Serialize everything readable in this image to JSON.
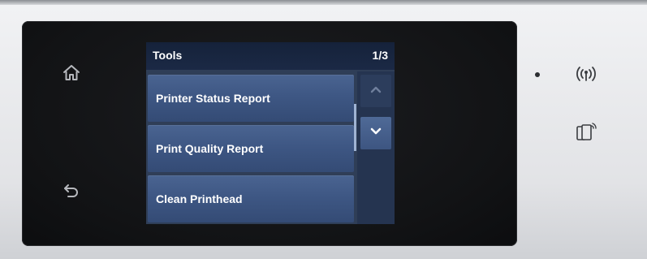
{
  "screen": {
    "title": "Tools",
    "page_indicator": "1/3"
  },
  "menu": {
    "items": [
      {
        "label": "Printer Status Report"
      },
      {
        "label": "Print Quality Report"
      },
      {
        "label": "Clean Printhead"
      }
    ]
  },
  "icons": {
    "home": "home-icon",
    "back": "back-arrow-icon",
    "scroll_up": "chevron-up-icon",
    "scroll_down": "chevron-down-icon",
    "wireless": "wireless-icon",
    "nfc": "nfc-tap-icon"
  },
  "colors": {
    "panel": "#121315",
    "menu_item": "#3e5784",
    "header": "#1b2945",
    "bezel": "#e7e8ea"
  }
}
